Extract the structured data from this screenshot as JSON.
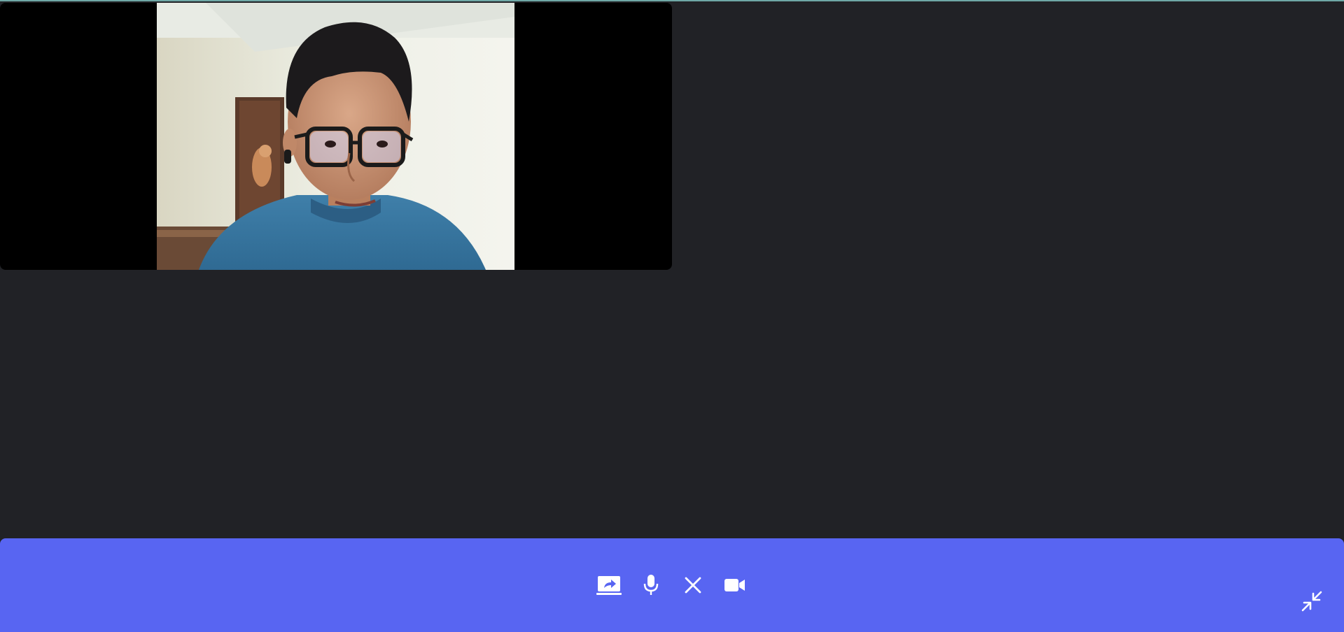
{
  "call": {
    "participant_video": {
      "icon": "person-webcam-feed"
    }
  },
  "control_bar": {
    "background": "#5865f2",
    "buttons": [
      {
        "name": "screen-share",
        "icon": "screen-share-icon"
      },
      {
        "name": "microphone",
        "icon": "microphone-icon"
      },
      {
        "name": "end-call",
        "icon": "close-icon"
      },
      {
        "name": "camera",
        "icon": "video-camera-icon"
      }
    ],
    "minimize_icon": "minimize-arrows-icon"
  },
  "colors": {
    "page_background": "#212226",
    "video_background": "#000000",
    "control_bar": "#5865f2",
    "icon": "#ffffff"
  }
}
